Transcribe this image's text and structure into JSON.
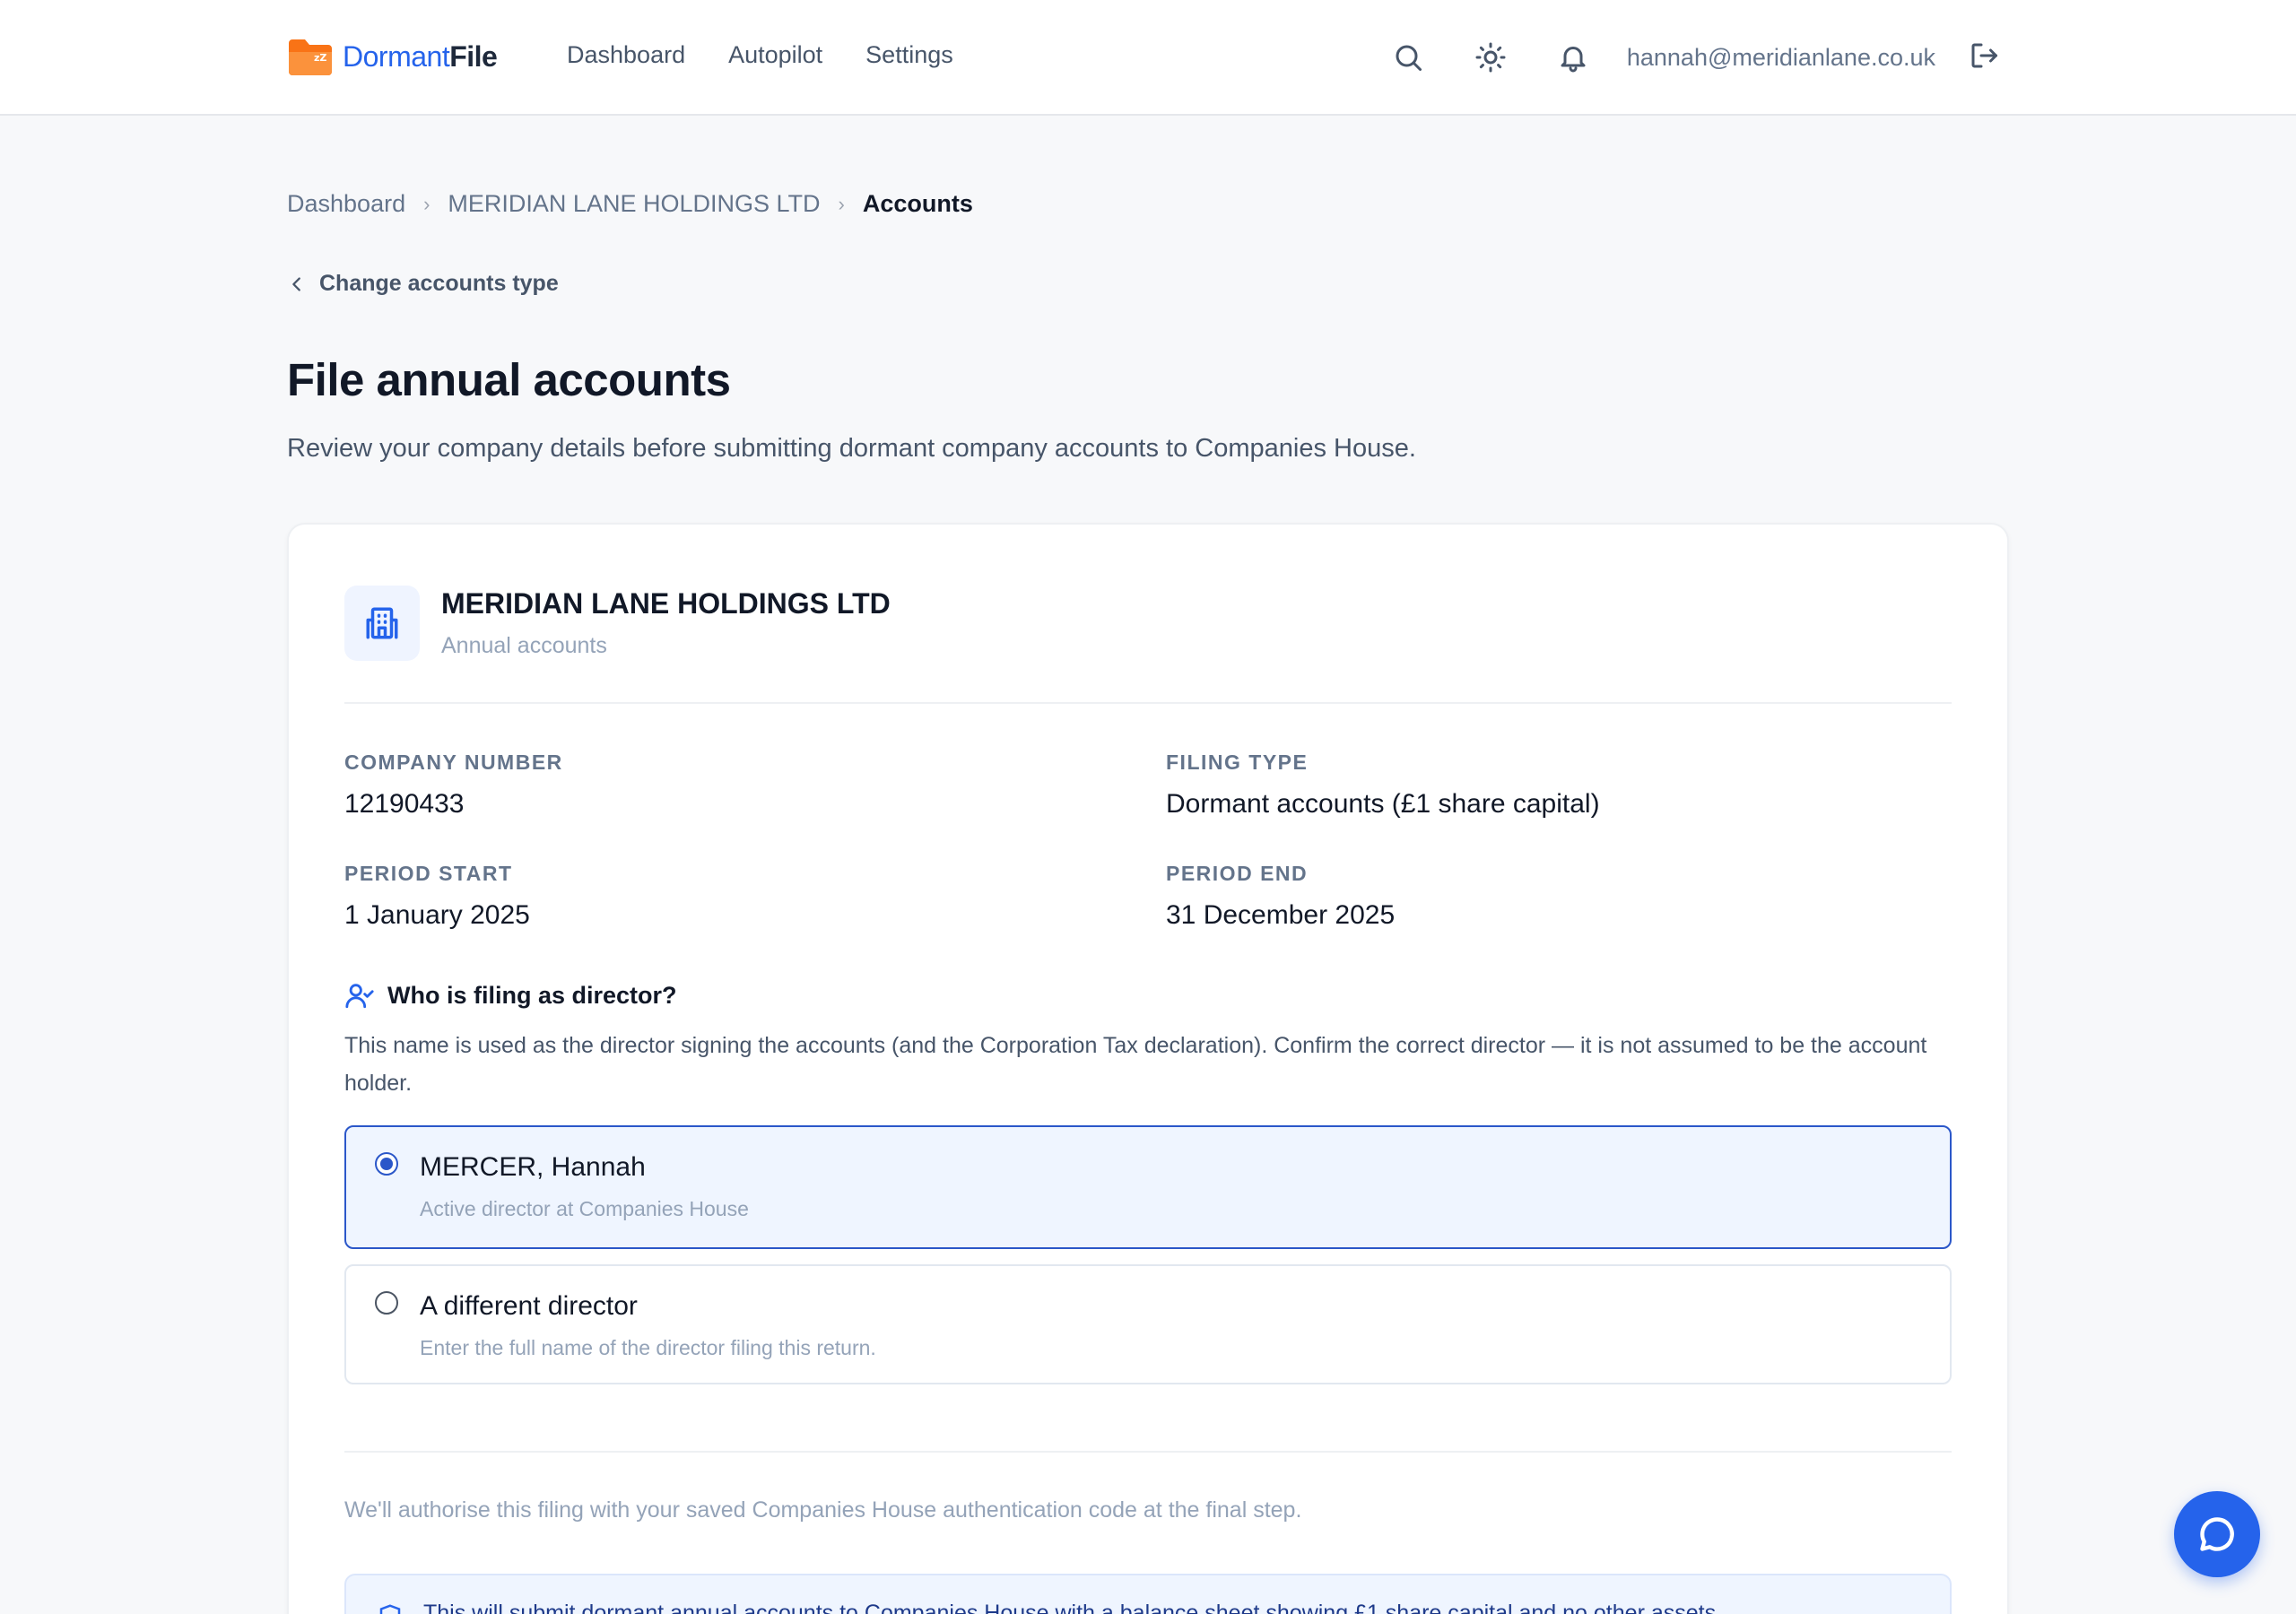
{
  "brand": {
    "name_part1": "Dormant",
    "name_part2": "File",
    "accent": "#2563eb",
    "logo_color": "#f97316"
  },
  "nav": {
    "items": [
      {
        "label": "Dashboard"
      },
      {
        "label": "Autopilot"
      },
      {
        "label": "Settings"
      }
    ]
  },
  "header": {
    "icons": [
      "search-icon",
      "sun-icon",
      "bell-icon",
      "logout-icon"
    ],
    "user_email": "hannah@meridianlane.co.uk"
  },
  "breadcrumb": {
    "items": [
      "Dashboard",
      "MERIDIAN LANE HOLDINGS LTD",
      "Accounts"
    ]
  },
  "back_link": {
    "label": "Change accounts type"
  },
  "page": {
    "title": "File annual accounts",
    "subtitle": "Review your company details before submitting dormant company accounts to Companies House."
  },
  "company": {
    "name": "MERIDIAN LANE HOLDINGS LTD",
    "subtitle": "Annual accounts",
    "fields": {
      "company_number": {
        "label": "COMPANY NUMBER",
        "value": "12190433"
      },
      "filing_type": {
        "label": "FILING TYPE",
        "value": "Dormant accounts (£1 share capital)"
      },
      "period_start": {
        "label": "PERIOD START",
        "value": "1 January 2025"
      },
      "period_end": {
        "label": "PERIOD END",
        "value": "31 December 2025"
      }
    }
  },
  "director": {
    "question": "Who is filing as director?",
    "help": "This name is used as the director signing the accounts (and the Corporation Tax declaration). Confirm the correct director — it is not assumed to be the account holder.",
    "options": [
      {
        "title": "MERCER, Hannah",
        "subtitle": "Active director at Companies House",
        "selected": true
      },
      {
        "title": "A different director",
        "subtitle": "Enter the full name of the director filing this return.",
        "selected": false
      }
    ]
  },
  "auth_note": "We'll authorise this filing with your saved Companies House authentication code at the final step.",
  "info_box": {
    "text": "This will submit dormant annual accounts to Companies House with a balance sheet showing £1 share capital and no other assets."
  }
}
